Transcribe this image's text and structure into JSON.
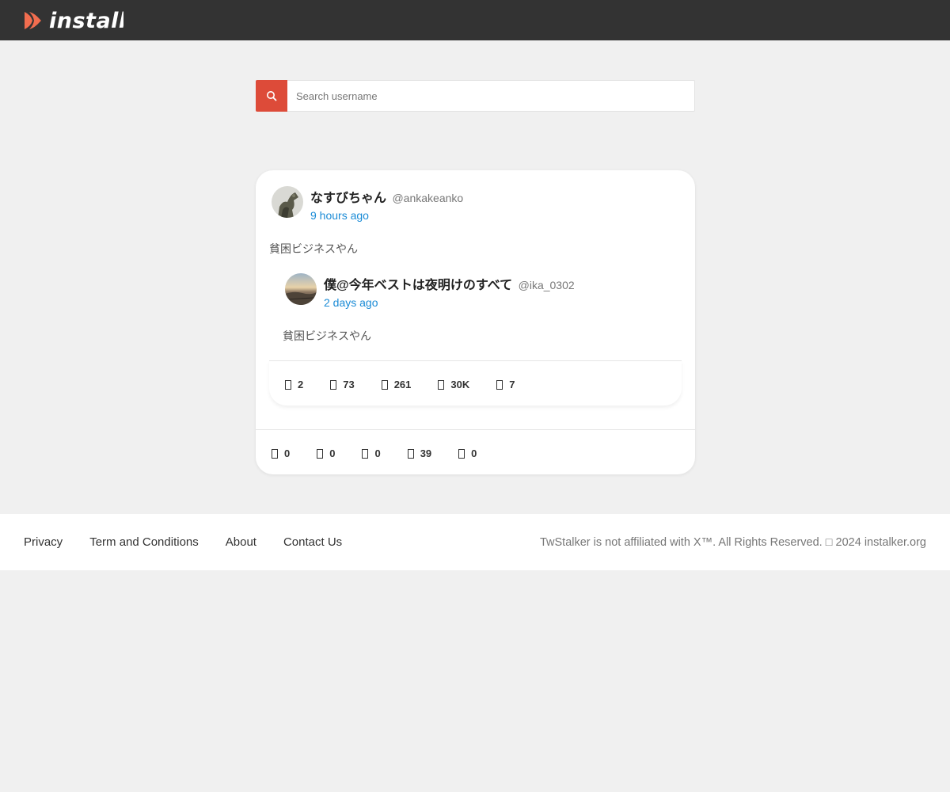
{
  "header": {
    "logo_text": "instalker",
    "brand_color": "#f26d4f",
    "background_color": "#333333"
  },
  "search": {
    "placeholder": "Search username",
    "button_icon": "search-icon",
    "button_color": "#dd4b39"
  },
  "post": {
    "display_name": "なすびちゃん",
    "handle": "@ankakeanko",
    "time": "9 hours ago",
    "text": "貧困ビジネスやん",
    "quoted": {
      "display_name": "僕@今年ベストは夜明けのすべて",
      "handle": "@ika_0302",
      "time": "2 days ago",
      "text": "貧困ビジネスやん",
      "stats": [
        {
          "icon": "comment-icon",
          "value": "2"
        },
        {
          "icon": "retweet-icon",
          "value": "73"
        },
        {
          "icon": "heart-icon",
          "value": "261"
        },
        {
          "icon": "chart-icon",
          "value": "30K"
        },
        {
          "icon": "bookmark-icon",
          "value": "7"
        }
      ]
    },
    "stats": [
      {
        "icon": "comment-icon",
        "value": "0"
      },
      {
        "icon": "retweet-icon",
        "value": "0"
      },
      {
        "icon": "heart-icon",
        "value": "0"
      },
      {
        "icon": "chart-icon",
        "value": "39"
      },
      {
        "icon": "bookmark-icon",
        "value": "0"
      }
    ]
  },
  "footer": {
    "links": [
      "Privacy",
      "Term and Conditions",
      "About",
      "Contact Us"
    ],
    "copyright": "TwStalker is not affiliated with X™. All Rights Reserved. □ 2024 instalker.org"
  }
}
